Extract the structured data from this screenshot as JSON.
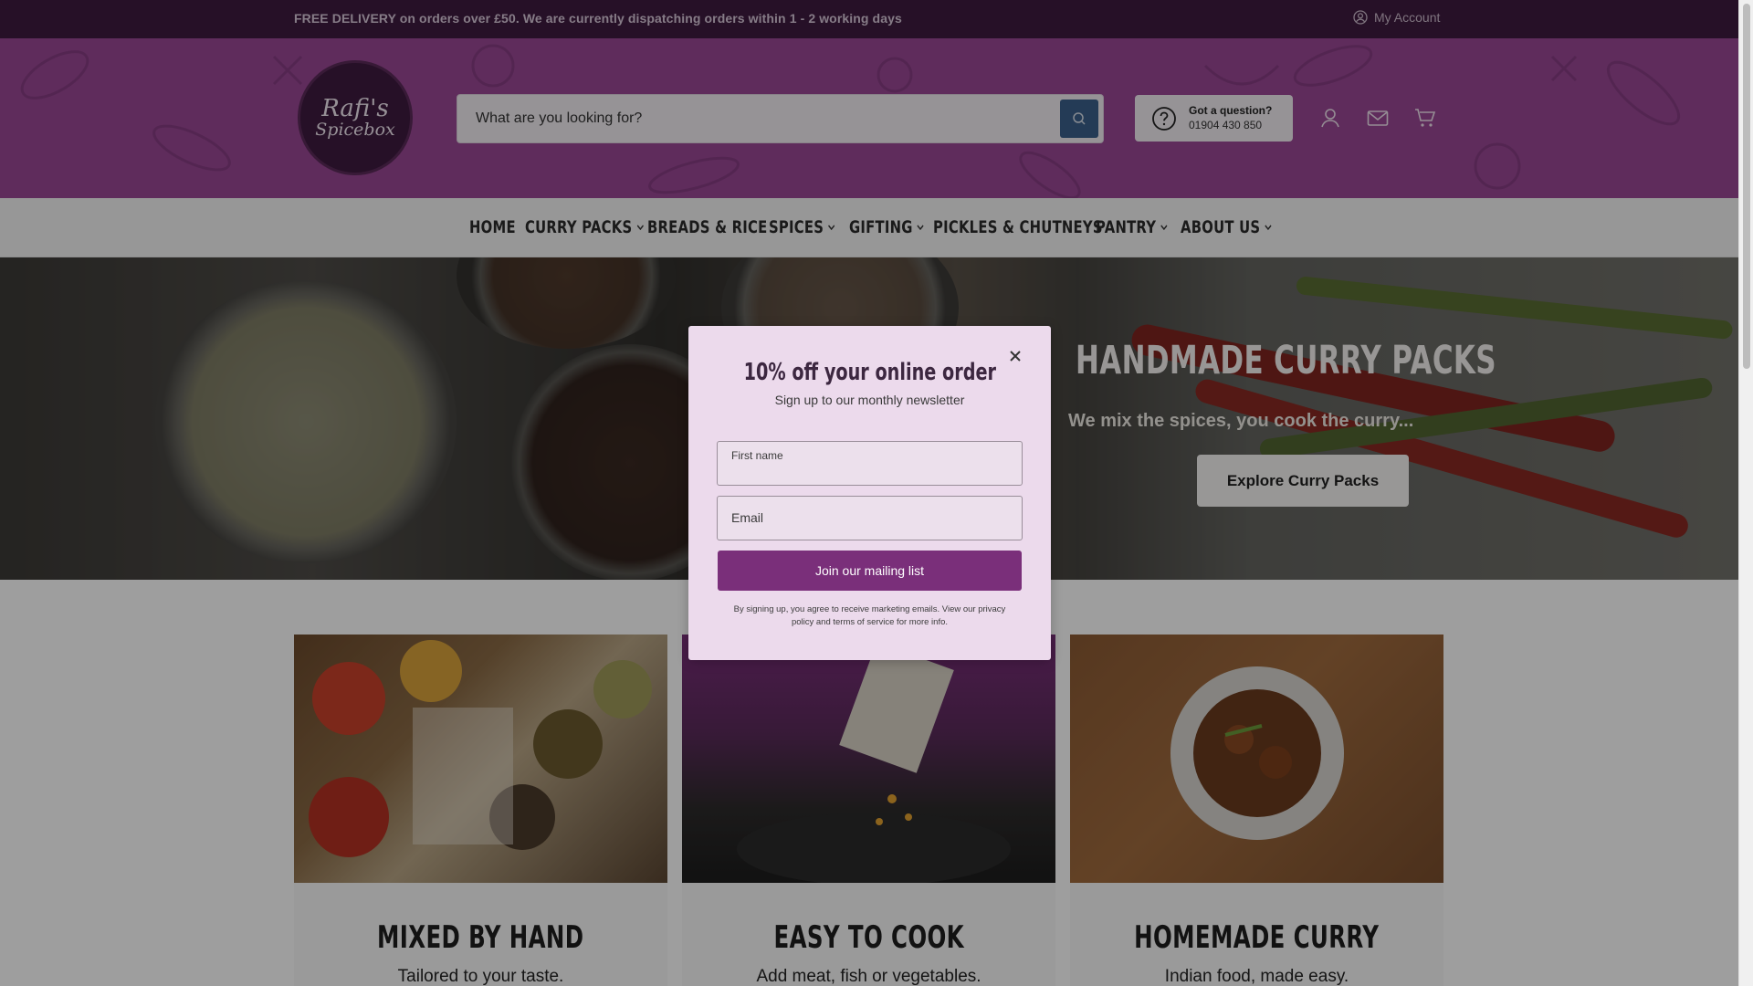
{
  "announcement": {
    "message": "FREE DELIVERY on orders over £50. We are currently dispatching orders within 1 - 2 working days",
    "account_label": "My Account"
  },
  "header": {
    "logo_line1": "Rafi's",
    "logo_line2": "Spicebox",
    "search_placeholder": "What are you looking for?",
    "question_title": "Got a question?",
    "question_phone": "01904 430 850"
  },
  "nav": {
    "items": [
      {
        "label": "HOME",
        "dropdown": false
      },
      {
        "label": "CURRY PACKS",
        "dropdown": true
      },
      {
        "label": "BREADS & RICE",
        "dropdown": false
      },
      {
        "label": "SPICES",
        "dropdown": true
      },
      {
        "label": "GIFTING",
        "dropdown": true
      },
      {
        "label": "PICKLES & CHUTNEYS",
        "dropdown": false
      },
      {
        "label": "PANTRY",
        "dropdown": true
      },
      {
        "label": "ABOUT US",
        "dropdown": true
      }
    ]
  },
  "hero": {
    "title": "HANDMADE CURRY PACKS",
    "subtitle": "We mix the spices, you cook the curry...",
    "button_label": "Explore Curry Packs"
  },
  "cards": [
    {
      "title": "MIXED BY HAND",
      "subtitle": "Tailored to your taste."
    },
    {
      "title": "EASY TO COOK",
      "subtitle": "Add meat, fish or vegetables."
    },
    {
      "title": "HOMEMADE CURRY",
      "subtitle": "Indian food, made easy."
    }
  ],
  "modal": {
    "title": "10% off your online order",
    "subtitle": "Sign up to our monthly newsletter",
    "first_name_label": "First name",
    "email_label": "Email",
    "join_label": "Join our mailing list",
    "legal": "By signing up, you agree to receive marketing emails. View our privacy policy and terms of service for more info."
  },
  "colors": {
    "announcement_bg": "#3e1a3f",
    "header_bg": "#9a4795",
    "brand_purple": "#7a2f7a",
    "search_button": "#3b5f8c"
  }
}
